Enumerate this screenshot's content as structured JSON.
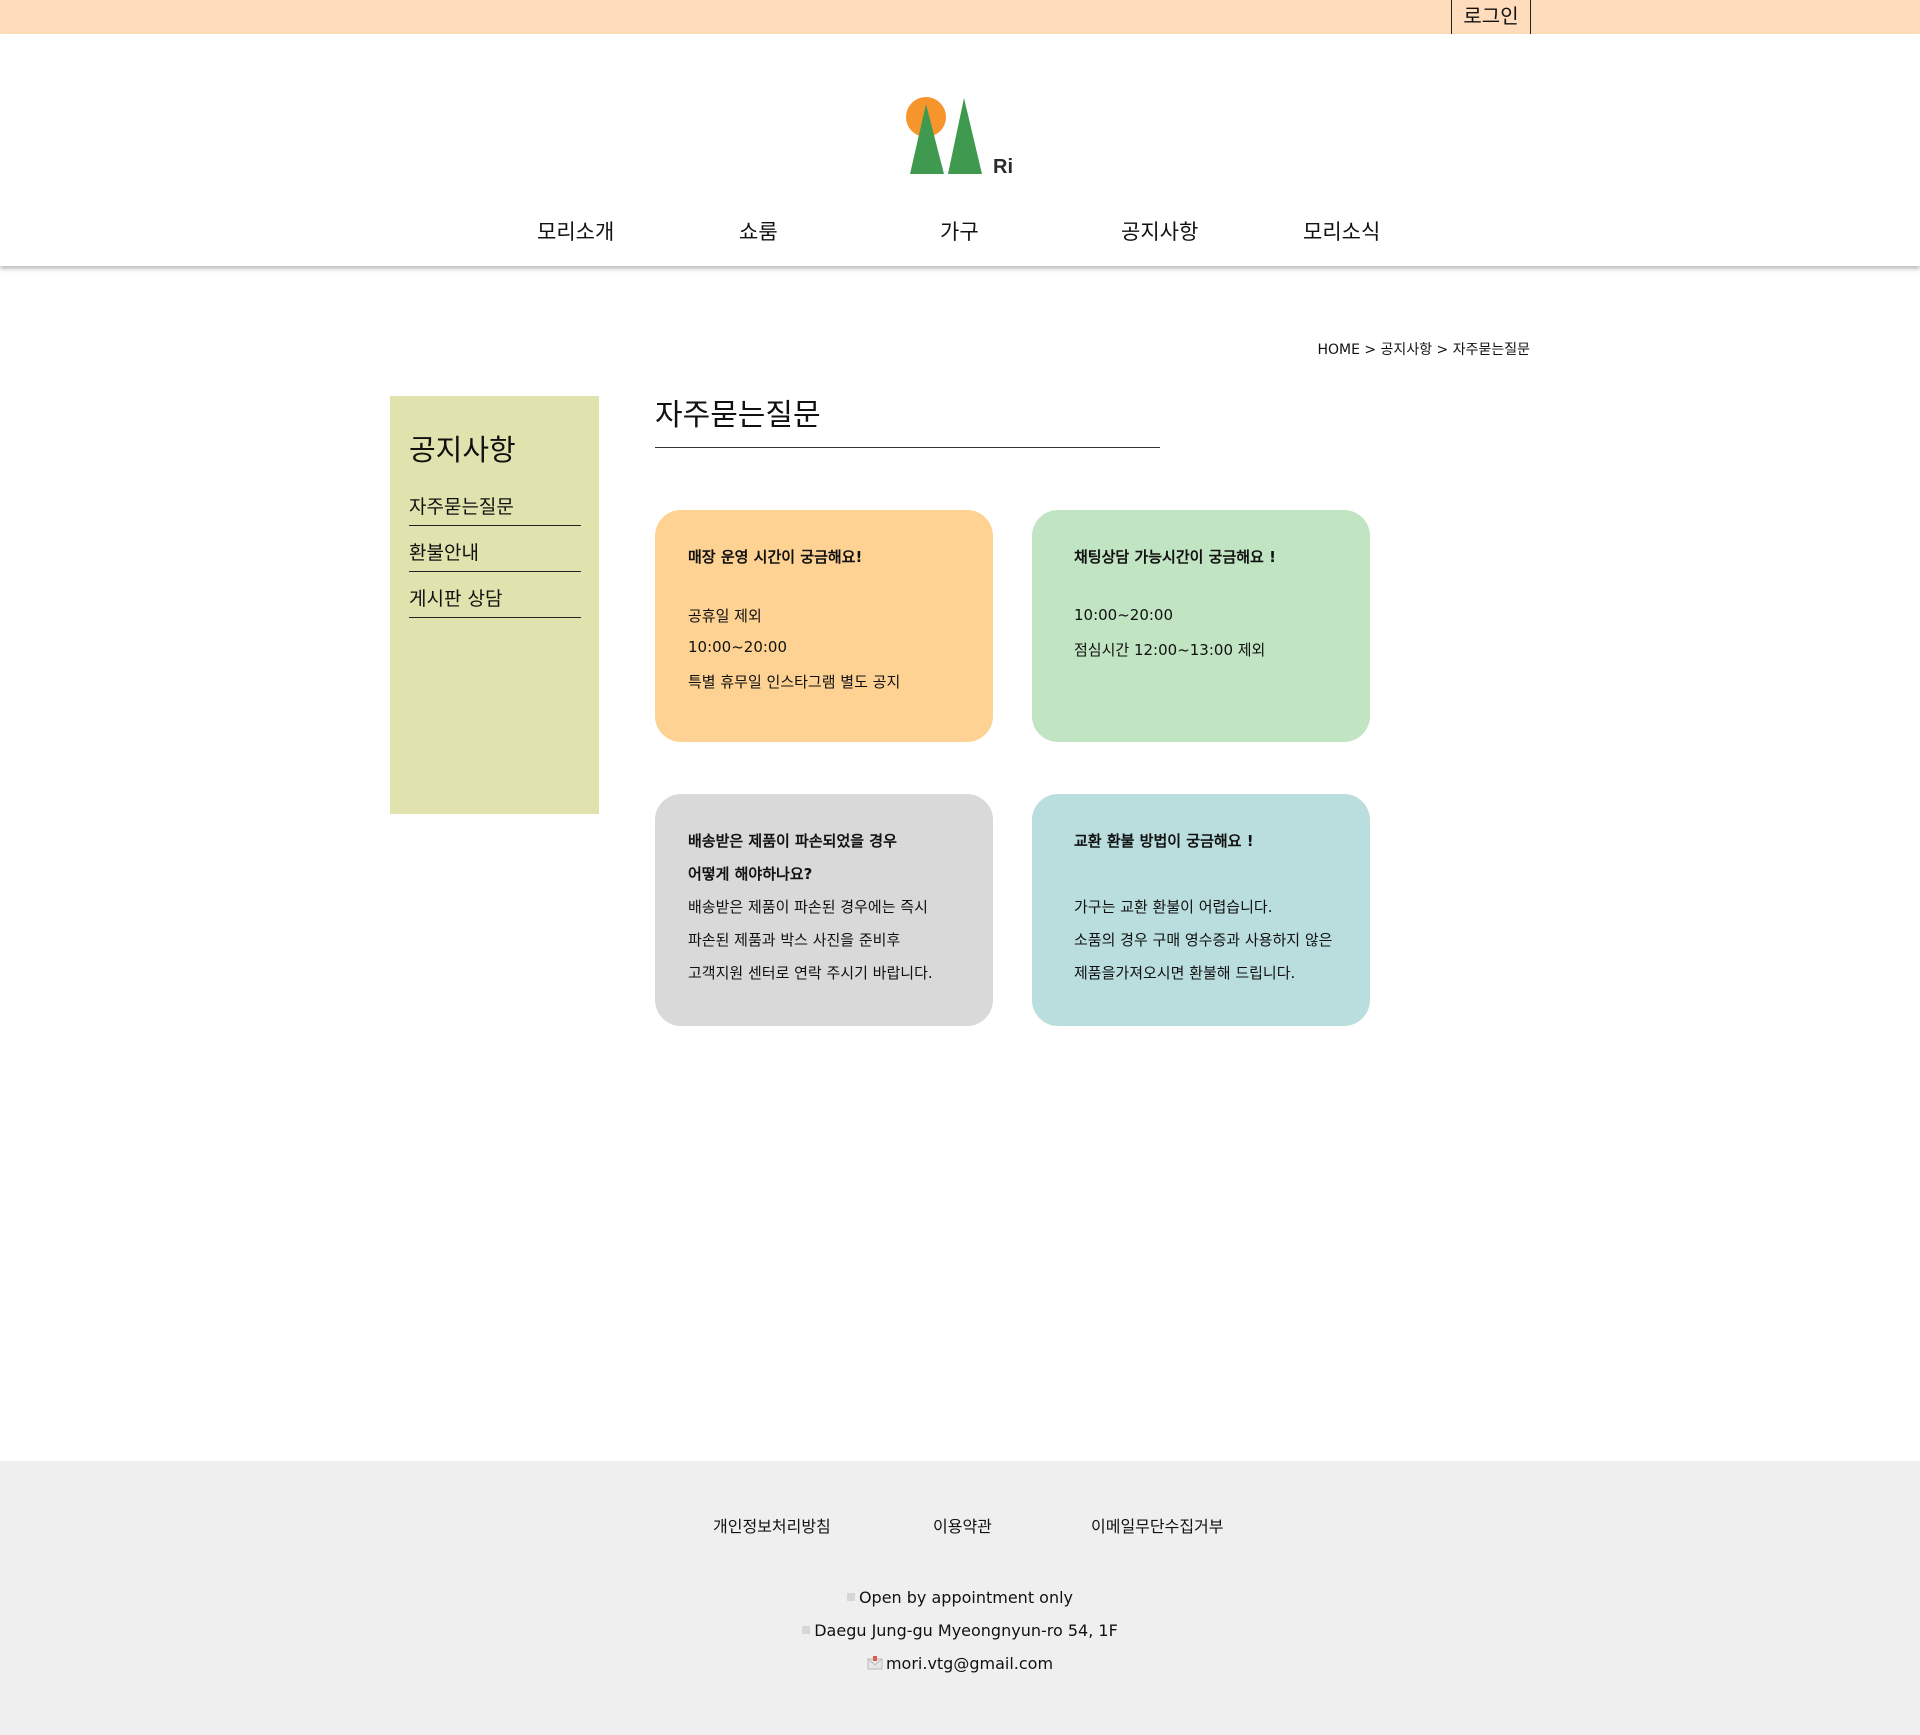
{
  "topbar": {
    "login_label": "로그인"
  },
  "header": {
    "logo_text": "Ri",
    "nav": [
      "모리소개",
      "쇼룸",
      "가구",
      "공지사항",
      "모리소식"
    ]
  },
  "breadcrumb": "HOME > 공지사항 > 자주묻는질문",
  "sidebar": {
    "title": "공지사항",
    "items": [
      "자주묻는질문",
      "환불안내",
      "게시판 상담"
    ]
  },
  "main": {
    "title": "자주묻는질문",
    "cards": [
      {
        "question": "매장 운영 시간이 궁금해요!",
        "lines": [
          "공휴일 제외",
          "10:00~20:00",
          "특별 휴무일 인스타그램 별도 공지"
        ]
      },
      {
        "question": "채팅상담 가능시간이 궁금해요 !",
        "lines": [
          "10:00~20:00",
          "점심시간 12:00~13:00 제외"
        ]
      },
      {
        "question_lines": [
          "배송받은 제품이 파손되었을 경우",
          "어떻게 해야하나요?"
        ],
        "lines": [
          "배송받은 제품이 파손된 경우에는 즉시",
          "파손된 제품과 박스 사진을 준비후",
          "고객지원 센터로 연락 주시기 바랍니다."
        ]
      },
      {
        "question": "교환 환불 방법이 궁금해요 !",
        "lines": [
          "가구는 교환 환불이 어렵습니다.",
          "소품의 경우 구매 영수증과 사용하지 않은",
          "제품을가져오시면 환불해 드립니다."
        ]
      }
    ]
  },
  "footer": {
    "links": [
      "개인정보처리방침",
      "이용약관",
      "이메일무단수집거부"
    ],
    "info": [
      "Open by appointment only",
      "Daegu Jung-gu Myeongnyun-ro 54, 1F",
      "mori.vtg@gmail.com"
    ]
  },
  "colors": {
    "topbar": "#ffdcbb",
    "sidebar": "#e0e3ad",
    "card_orange": "#fed292",
    "card_green": "#c1e4c3",
    "card_gray": "#d9d9d9",
    "card_teal": "#b9dedd",
    "footer": "#efefef",
    "logo_sun": "#f6952b",
    "logo_trees": "#3f9a50"
  }
}
